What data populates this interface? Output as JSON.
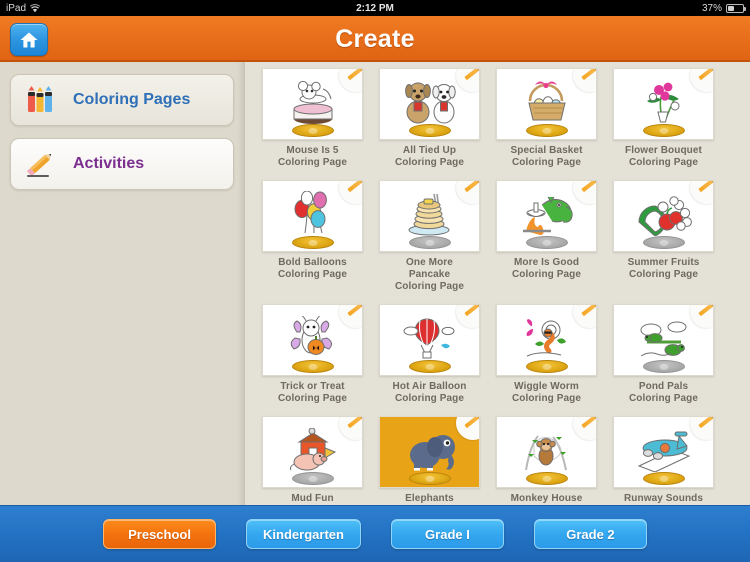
{
  "statusbar": {
    "device": "iPad",
    "wifi_icon": "wifi-icon",
    "time": "2:12 PM",
    "battery_percent": "37%",
    "battery_icon": "battery-icon"
  },
  "header": {
    "title": "Create",
    "home_icon": "home-icon",
    "background_color": "#e9701c"
  },
  "sidebar": {
    "items": [
      {
        "label": "Coloring Pages",
        "icon": "crayons-icon",
        "selected": false,
        "color": "#2e6fb7"
      },
      {
        "label": "Activities",
        "icon": "pencil-icon",
        "selected": true,
        "color": "#7b2f8f"
      }
    ]
  },
  "main": {
    "cards": [
      {
        "title": "Mouse Is 5\nColoring Page",
        "badge_icon": "pencil-icon",
        "base": "gold",
        "bg": "white",
        "art": "mouse-cake"
      },
      {
        "title": "All Tied Up\nColoring Page",
        "badge_icon": "pencil-icon",
        "base": "gold",
        "bg": "white",
        "art": "two-dogs"
      },
      {
        "title": "Special Basket\nColoring Page",
        "badge_icon": "pencil-icon",
        "base": "gold",
        "bg": "white",
        "art": "easter-basket"
      },
      {
        "title": "Flower Bouquet\nColoring Page",
        "badge_icon": "pencil-icon",
        "base": "gold",
        "bg": "white",
        "art": "flower-bouquet"
      },
      {
        "title": "Bold Balloons\nColoring Page",
        "badge_icon": "pencil-icon",
        "base": "gold",
        "bg": "white",
        "art": "balloons"
      },
      {
        "title": "One More\nPancake\nColoring Page",
        "badge_icon": "pencil-icon",
        "base": "gray",
        "bg": "white",
        "art": "pancakes"
      },
      {
        "title": "More Is Good\nColoring Page",
        "badge_icon": "pencil-icon",
        "base": "gray",
        "bg": "white",
        "art": "dragon-campfire"
      },
      {
        "title": "Summer Fruits\nColoring Page",
        "badge_icon": "pencil-icon",
        "base": "gray",
        "bg": "white",
        "art": "summer-fruits"
      },
      {
        "title": "Trick or Treat\nColoring Page",
        "badge_icon": "pencil-icon",
        "base": "gold",
        "bg": "white",
        "art": "butterfly-pumpkin"
      },
      {
        "title": "Hot Air Balloon\nColoring Page",
        "badge_icon": "pencil-icon",
        "base": "gold",
        "bg": "white",
        "art": "hot-air-balloon"
      },
      {
        "title": "Wiggle Worm\nColoring Page",
        "badge_icon": "pencil-icon",
        "base": "gold",
        "bg": "white",
        "art": "worm-butterfly"
      },
      {
        "title": "Pond Pals\nColoring Page",
        "badge_icon": "pencil-icon",
        "base": "gray",
        "bg": "white",
        "art": "pond-turtles"
      },
      {
        "title": "Mud Fun",
        "badge_icon": "pencil-icon",
        "base": "gray",
        "bg": "white",
        "art": "pig-barn"
      },
      {
        "title": "Elephants",
        "badge_icon": "pencil-icon",
        "base": "gold",
        "bg": "amber",
        "art": "elephant"
      },
      {
        "title": "Monkey House",
        "badge_icon": "pencil-icon",
        "base": "gold",
        "bg": "white",
        "art": "monkey-tree"
      },
      {
        "title": "Runway Sounds",
        "badge_icon": "pencil-icon",
        "base": "gold",
        "bg": "white",
        "art": "airplane"
      }
    ]
  },
  "bottombar": {
    "buttons": [
      {
        "label": "Preschool",
        "active": true
      },
      {
        "label": "Kindergarten",
        "active": false
      },
      {
        "label": "Grade I",
        "active": false
      },
      {
        "label": "Grade 2",
        "active": false
      }
    ],
    "active_color": "#f4730e",
    "inactive_color": "#34a7ef"
  }
}
